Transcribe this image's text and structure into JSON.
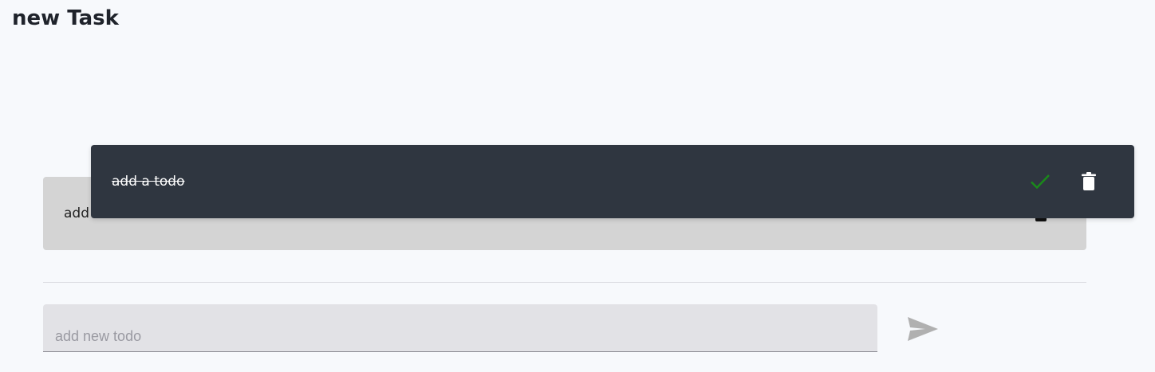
{
  "header": {
    "title": "new Task"
  },
  "todos": [
    {
      "text": "add another todo",
      "completed": false,
      "complete_icon": "check-icon",
      "delete_icon": "trash-icon",
      "background": "#d4d4d4"
    },
    {
      "text": "add a todo",
      "completed": true,
      "complete_icon": "check-icon",
      "delete_icon": "trash-icon",
      "background": "#2f3640",
      "check_color": "#1a8a1a"
    }
  ],
  "new_todo": {
    "placeholder": "add new todo",
    "value": "",
    "send_icon": "send-icon"
  },
  "colors": {
    "page_background": "#f7f9fc",
    "send_icon": "#b0b0b0"
  }
}
